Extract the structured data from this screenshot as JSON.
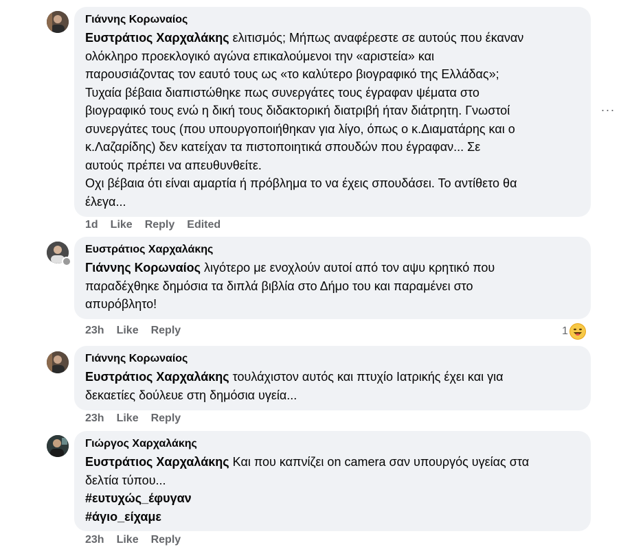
{
  "comments": [
    {
      "author": "Γιάννης Κορωναίος",
      "mention": "Ευστράτιος Χαρχαλάκης",
      "text": " ελιτισμός; Μήπως αναφέρεστε σε αυτούς που έκαναν\nολόκληρο προεκλογικό αγώνα επικαλούμενοι την «αριστεία» και\nπαρουσιάζοντας τον εαυτό τους ως «το καλύτερο βιογραφικό της Ελλάδας»;\nΤυχαία βέβαια διαπιστώθηκε πως συνεργάτες τους έγραφαν ψέματα στο\nβιογραφικό τους ενώ η δική τους διδακτορική διατριβή ήταν διάτρητη. Γνωστοί\nσυνεργάτες τους (που υπουργοποιήθηκαν για λίγο, όπως ο κ.Διαματάρης και ο\nκ.Λαζαρίδης) δεν κατείχαν τα πιστοποιητικά σπουδών που έγραφαν... Σε\nαυτούς πρέπει να απευθυνθείτε.\nΟχι βέβαια ότι είναι αμαρτία ή πρόβλημα το να έχεις σπουδάσει. Το αντίθετο θα\nέλεγα...",
      "time": "1d",
      "like": "Like",
      "reply": "Reply",
      "edited": "Edited"
    },
    {
      "author": "Ευστράτιος Χαρχαλάκης",
      "mention": "Γιάννης Κορωναίος",
      "text": " λιγότερο με ενοχλούν αυτοί από τον αψυ κρητικό που\nπαραδέχθηκε δημόσια τα διπλά βιβλία στο Δήμο του και παραμένει στο\nαπυρόβλητο!",
      "time": "23h",
      "like": "Like",
      "reply": "Reply",
      "reaction_count": "1"
    },
    {
      "author": "Γιάννης Κορωναίος",
      "mention": "Ευστράτιος Χαρχαλάκης",
      "text": " τουλάχιστον αυτός και πτυχίο Ιατρικής έχει και για\nδεκαετίες δούλευε στη δημόσια υγεία...",
      "time": "23h",
      "like": "Like",
      "reply": "Reply"
    },
    {
      "author": "Γιώργος Χαρχαλάκης",
      "mention": "Ευστράτιος Χαρχαλάκης",
      "text": " Και που καπνίζει on camera σαν υπουργός υγείας στα\nδελτία τύπου...",
      "hashtags": [
        "#ευτυχώς_έφυγαν",
        "#άγιο_είχαμε"
      ],
      "time": "23h",
      "like": "Like",
      "reply": "Reply"
    }
  ],
  "more_options": "···",
  "colors": {
    "bubble": "#f0f2f5",
    "meta": "#65676b",
    "text": "#050505"
  }
}
